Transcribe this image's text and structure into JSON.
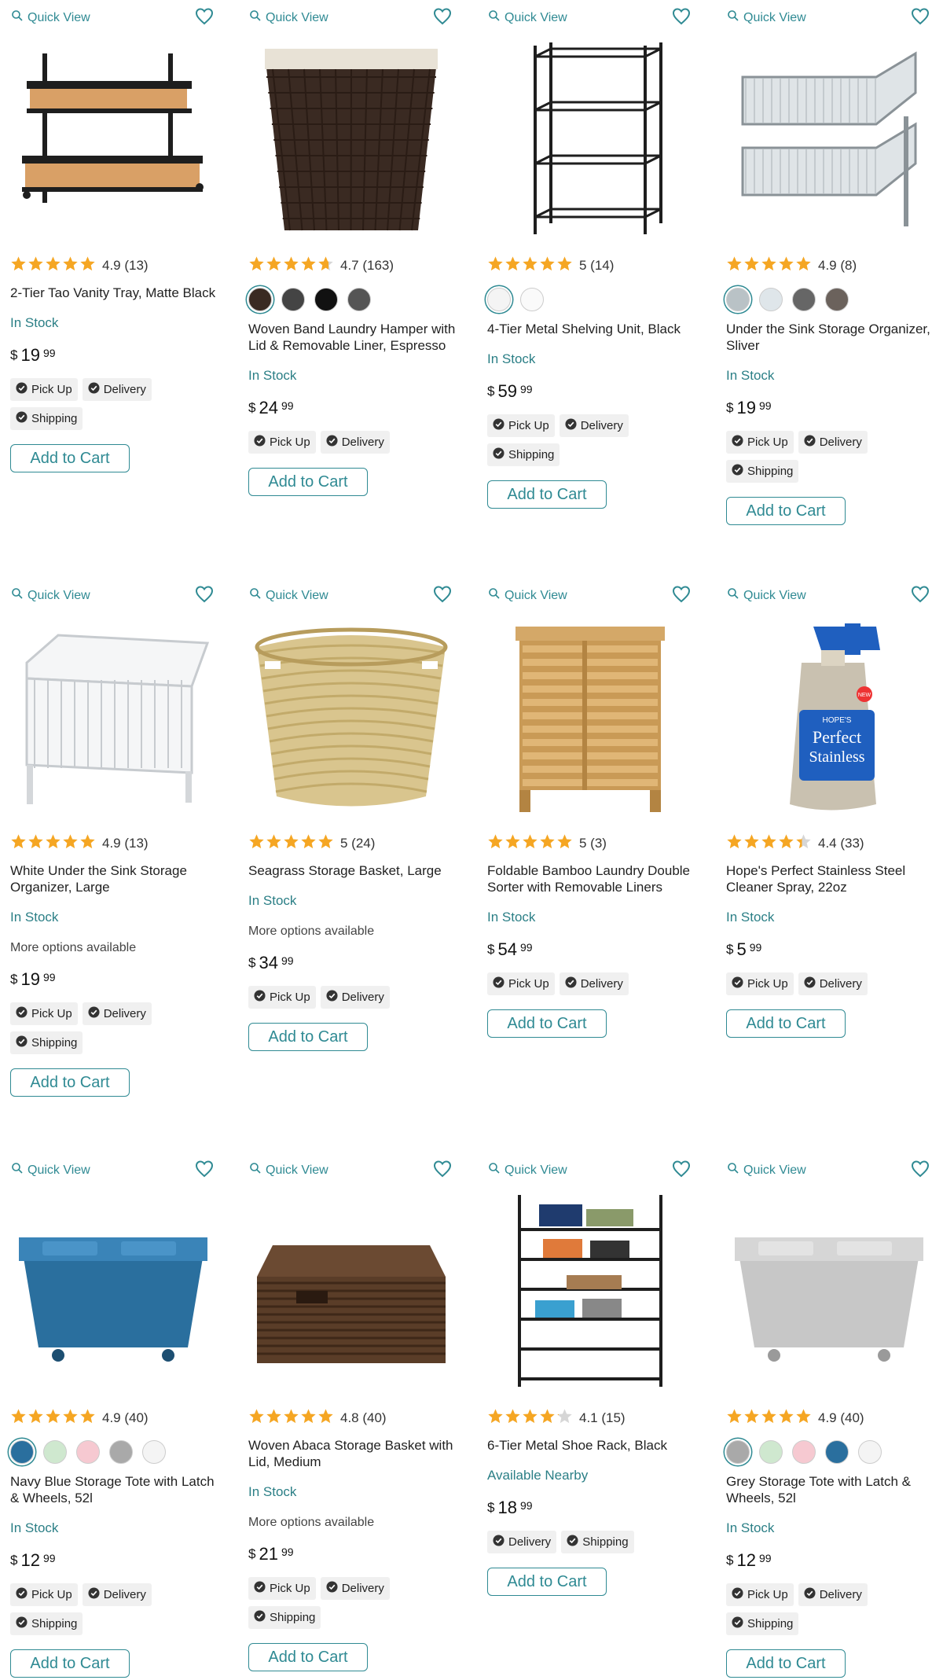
{
  "common": {
    "quick_view": "Quick View",
    "add_to_cart": "Add to Cart",
    "currency": "$"
  },
  "colors": {
    "accent": "#2f8a93",
    "star": "#f5a623"
  },
  "products": [
    {
      "rating": "4.9",
      "reviews": "(13)",
      "stars": 5,
      "title": "2-Tier Tao Vanity Tray, Matte Black",
      "stock": "In Stock",
      "more": "",
      "dollars": "19",
      "cents": "99",
      "swatches": [],
      "pills": [
        "Pick Up",
        "Delivery",
        "Shipping"
      ],
      "image": "vanity-tray"
    },
    {
      "rating": "4.7",
      "reviews": "(163)",
      "stars": 4.7,
      "title": "Woven Band Laundry Hamper with Lid & Removable Liner, Espresso",
      "stock": "In Stock",
      "more": "",
      "dollars": "24",
      "cents": "99",
      "swatches": [
        "#3a2a22",
        "#444",
        "#111",
        "#555"
      ],
      "pills": [
        "Pick Up",
        "Delivery"
      ],
      "image": "hamper"
    },
    {
      "rating": "5",
      "reviews": "(14)",
      "stars": 5,
      "title": "4-Tier Metal Shelving Unit, Black",
      "stock": "In Stock",
      "more": "",
      "dollars": "59",
      "cents": "99",
      "swatches": [
        "#f4f4f4",
        "#fafafa"
      ],
      "pills": [
        "Pick Up",
        "Delivery",
        "Shipping"
      ],
      "image": "shelving"
    },
    {
      "rating": "4.9",
      "reviews": "(8)",
      "stars": 5,
      "title": "Under the Sink Storage Organizer, Sliver",
      "stock": "In Stock",
      "more": "",
      "dollars": "19",
      "cents": "99",
      "swatches": [
        "#b9c2c6",
        "#dfe6ea",
        "#666",
        "#6b625c"
      ],
      "pills": [
        "Pick Up",
        "Delivery",
        "Shipping"
      ],
      "image": "sink-organizer"
    },
    {
      "rating": "4.9",
      "reviews": "(13)",
      "stars": 5,
      "title": "White Under the Sink Storage Organizer, Large",
      "stock": "In Stock",
      "more": "More options available",
      "dollars": "19",
      "cents": "99",
      "swatches": [],
      "pills": [
        "Pick Up",
        "Delivery",
        "Shipping"
      ],
      "image": "white-organizer"
    },
    {
      "rating": "5",
      "reviews": "(24)",
      "stars": 5,
      "title": "Seagrass Storage Basket, Large",
      "stock": "In Stock",
      "more": "More options available",
      "dollars": "34",
      "cents": "99",
      "swatches": [],
      "pills": [
        "Pick Up",
        "Delivery"
      ],
      "image": "seagrass"
    },
    {
      "rating": "5",
      "reviews": "(3)",
      "stars": 5,
      "title": "Foldable Bamboo Laundry Double Sorter with Removable Liners",
      "stock": "In Stock",
      "more": "",
      "dollars": "54",
      "cents": "99",
      "swatches": [],
      "pills": [
        "Pick Up",
        "Delivery"
      ],
      "image": "bamboo"
    },
    {
      "rating": "4.4",
      "reviews": "(33)",
      "stars": 4.4,
      "title": "Hope's Perfect Stainless Steel Cleaner Spray, 22oz",
      "stock": "In Stock",
      "more": "",
      "dollars": "5",
      "cents": "99",
      "swatches": [],
      "pills": [
        "Pick Up",
        "Delivery"
      ],
      "image": "spray",
      "label_brand": "HOPE'S",
      "label_line1": "Perfect",
      "label_line2": "Stainless",
      "label_badge": "NEW"
    },
    {
      "rating": "4.9",
      "reviews": "(40)",
      "stars": 5,
      "title": "Navy Blue Storage Tote with Latch & Wheels, 52l",
      "stock": "In Stock",
      "more": "",
      "dollars": "12",
      "cents": "99",
      "swatches": [
        "#2a6f9e",
        "#cfe8cf",
        "#f6c9d1",
        "#a9a9a9",
        "#f4f4f4"
      ],
      "pills": [
        "Pick Up",
        "Delivery",
        "Shipping"
      ],
      "image": "blue-tote"
    },
    {
      "rating": "4.8",
      "reviews": "(40)",
      "stars": 5,
      "title": "Woven Abaca Storage Basket with Lid, Medium",
      "stock": "In Stock",
      "more": "More options available",
      "dollars": "21",
      "cents": "99",
      "swatches": [],
      "pills": [
        "Pick Up",
        "Delivery",
        "Shipping"
      ],
      "image": "abaca"
    },
    {
      "rating": "4.1",
      "reviews": "(15)",
      "stars": 4.1,
      "title": "6-Tier Metal Shoe Rack, Black",
      "stock": "Available Nearby",
      "more": "",
      "dollars": "18",
      "cents": "99",
      "swatches": [],
      "pills": [
        "Delivery",
        "Shipping"
      ],
      "image": "shoe-rack"
    },
    {
      "rating": "4.9",
      "reviews": "(40)",
      "stars": 5,
      "title": "Grey Storage Tote with Latch & Wheels, 52l",
      "stock": "In Stock",
      "more": "",
      "dollars": "12",
      "cents": "99",
      "swatches": [
        "#a9a9a9",
        "#cfe8cf",
        "#f6c9d1",
        "#2a6f9e",
        "#f4f4f4"
      ],
      "pills": [
        "Pick Up",
        "Delivery",
        "Shipping"
      ],
      "image": "grey-tote"
    }
  ]
}
